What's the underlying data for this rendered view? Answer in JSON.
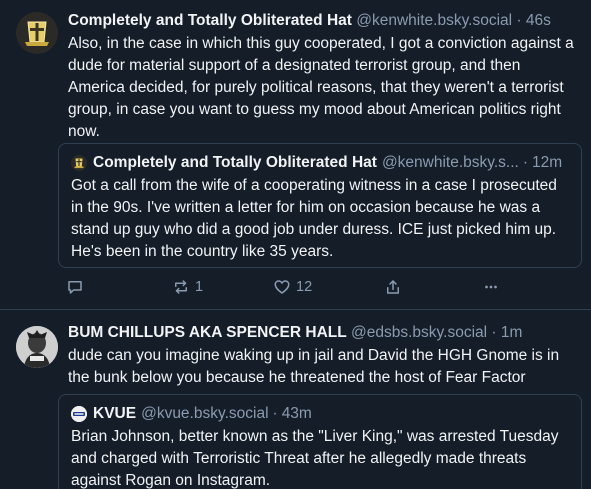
{
  "posts": [
    {
      "author": {
        "name": "Completely and Totally Obliterated Hat",
        "handle": "@kenwhite.bsky.social",
        "time": "46s"
      },
      "text": "Also, in the case in which this guy cooperated, I got a conviction against a dude for material support of a designated terrorist group, and then America decided, for purely political reasons, that they weren't a terrorist group, in case you want to guess my mood about American politics right now.",
      "quote": {
        "name": "Completely and Totally Obliterated Hat",
        "handle": "@kenwhite.bsky.s...",
        "time": "12m",
        "text": "Got a call from the wife of a cooperating witness in a case I prosecuted in the 90s.  I've written a letter for him on occasion because he was a stand up guy who did a good job under duress.  ICE just picked him up.  He's been in the country like 35 years."
      },
      "actions": {
        "reposts": "1",
        "likes": "12"
      }
    },
    {
      "author": {
        "name": "BUM CHILLUPS AKA SPENCER HALL",
        "handle": "@edsbs.bsky.social",
        "time": "1m"
      },
      "text": "dude can you imagine waking up in jail and David the HGH Gnome is in the bunk below you because he threatened the host of Fear Factor",
      "quote": {
        "name": "KVUE",
        "handle": "@kvue.bsky.social",
        "time": "43m",
        "text": "Brian Johnson, better known as the \"Liver King,\" was arrested Tuesday and charged with Terroristic Threat after he allegedly made threats against Rogan on Instagram."
      }
    }
  ],
  "separator": "·",
  "colors": {
    "background": "#151d28",
    "border": "#2e4052",
    "muted": "#8a9bb0",
    "text": "#f1f3f5"
  },
  "icons": [
    "reply-icon",
    "repost-icon",
    "like-icon",
    "share-icon",
    "more-icon"
  ]
}
